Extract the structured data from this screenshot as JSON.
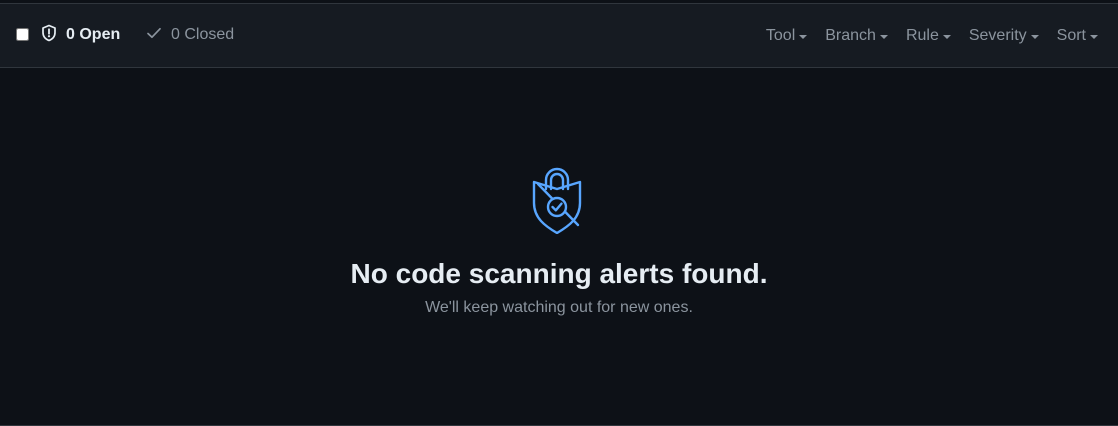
{
  "header": {
    "open_label": "0 Open",
    "closed_label": "0 Closed",
    "filters": [
      {
        "label": "Tool"
      },
      {
        "label": "Branch"
      },
      {
        "label": "Rule"
      },
      {
        "label": "Severity"
      },
      {
        "label": "Sort"
      }
    ]
  },
  "empty_state": {
    "icon": "shield-lock-check-icon",
    "title": "No code scanning alerts found.",
    "subtitle": "We'll keep watching out for new ones."
  },
  "colors": {
    "background": "#0d1117",
    "header_background": "#161b22",
    "border": "#30363d",
    "accent": "#58a6ff",
    "text_primary": "#e6edf3",
    "text_muted": "#8b949e"
  }
}
